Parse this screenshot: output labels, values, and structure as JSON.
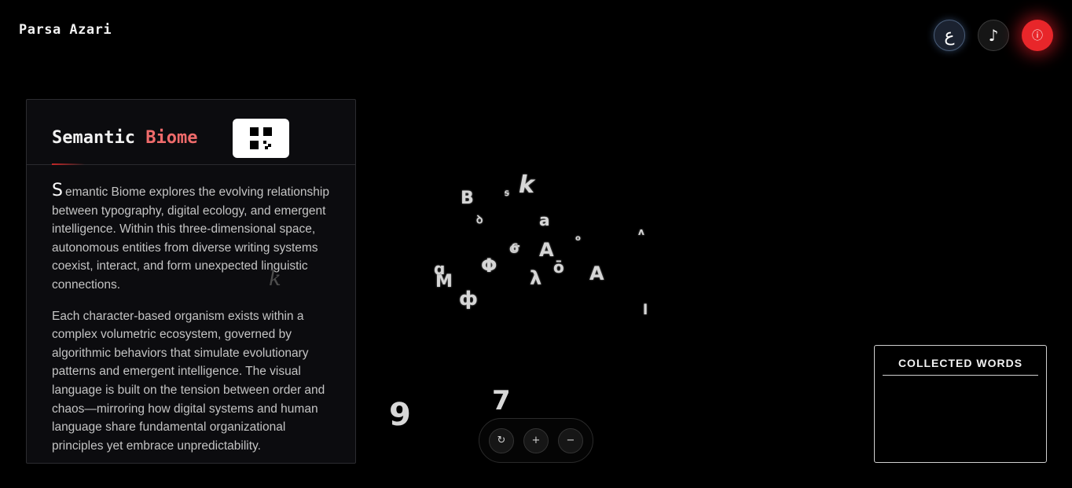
{
  "header": {
    "site_title": "Parsa Azari"
  },
  "top_controls": {
    "language_glyph": "ع",
    "music_glyph": "♪",
    "info_glyph": "ⓘ",
    "info_color": "#e8262a"
  },
  "info_panel": {
    "title_main": "Semantic",
    "title_accent": "Biome",
    "accent_color": "#ef6b6b",
    "dropcap": "S",
    "paragraph_1_rest": "emantic Biome explores the evolving relationship between typography, digital ecology, and emergent intelligence. Within this three-dimensional space, autonomous entities from diverse writing systems coexist, interact, and form unexpected linguistic connections.",
    "paragraph_2": "Each character-based organism exists within a complex volumetric ecosystem, governed by algorithmic behaviors that simulate evolutionary patterns and emergent intelligence. The visual language is built on the tension between order and chaos—mirroring how digital systems and human language share fundamental organizational principles yet embrace unpredictability.",
    "ghost_glyph": "k"
  },
  "glyphs": [
    "B",
    "k",
    "a",
    "A",
    "σ",
    "Φ",
    "λ",
    "ō",
    "A",
    "M",
    "ф",
    "ꝺ",
    "6",
    "o",
    "l",
    "ʌ",
    "ɑ",
    "ꟊ"
  ],
  "floating_numbers": [
    "9",
    "7"
  ],
  "toolbar": {
    "reset_glyph": "↻",
    "zoom_in_glyph": "+",
    "zoom_out_glyph": "−"
  },
  "collected_words": {
    "title": "COLLECTED WORDS",
    "items": []
  }
}
